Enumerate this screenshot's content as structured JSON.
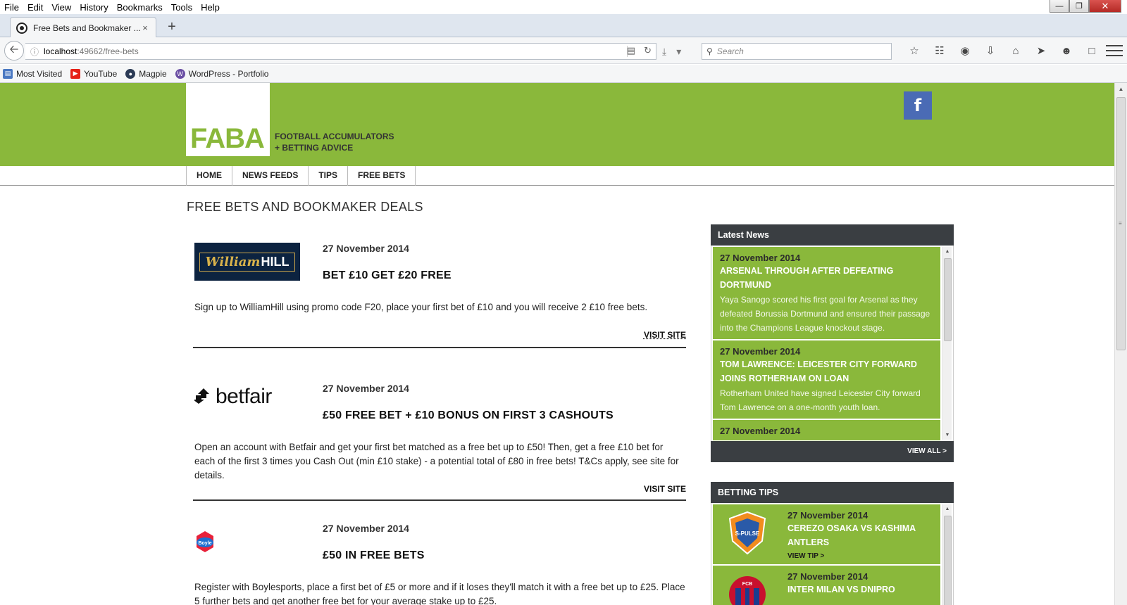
{
  "browser": {
    "menu": [
      "File",
      "Edit",
      "View",
      "History",
      "Bookmarks",
      "Tools",
      "Help"
    ],
    "tab_title": "Free Bets and Bookmaker ...",
    "tab_close": "×",
    "new_tab": "+",
    "url_host": "localhost",
    "url_path": ":49662/free-bets",
    "search_placeholder": "Search",
    "bookmarks": [
      {
        "label": "Most Visited",
        "icon": "most-visited-icon",
        "color": "#4a78c2"
      },
      {
        "label": "YouTube",
        "icon": "youtube-icon",
        "color": "#e62117"
      },
      {
        "label": "Magpie",
        "icon": "magpie-icon",
        "color": "#2b3a55"
      },
      {
        "label": "WordPress - Portfolio",
        "icon": "wordpress-icon",
        "color": "#6a4ea3"
      }
    ]
  },
  "site": {
    "logo": "FABA",
    "tagline_line1": "FOOTBALL ACCUMULATORS",
    "tagline_line2": "+ BETTING ADVICE",
    "facebook": "f",
    "nav": [
      "HOME",
      "NEWS FEEDS",
      "TIPS",
      "FREE BETS"
    ],
    "page_title": "FREE BETS AND BOOKMAKER DEALS"
  },
  "deals": [
    {
      "brand": "William HILL",
      "brand_part1": "William",
      "brand_part2": "HILL",
      "date": "27 November 2014",
      "headline": "BET £10 GET £20 FREE",
      "description": "Sign up to WilliamHill using promo code F20, place your first bet of £10 and you will receive 2 £10 free bets.",
      "visit": "VISIT SITE"
    },
    {
      "brand": "betfair",
      "date": "27 November 2014",
      "headline": "£50 FREE BET + £10 BONUS ON FIRST 3 CASHOUTS",
      "description": "Open an account with Betfair and get your first bet matched as a free bet up to £50! Then, get a free £10 bet for each of the first 3 times you Cash Out (min £10 stake) - a potential total of £80 in free bets! T&Cs apply, see site for details.",
      "visit": "VISIT SITE"
    },
    {
      "brand": "Boyle",
      "date": "27 November 2014",
      "headline": "£50 IN FREE BETS",
      "description": "Register with Boylesports, place a first bet of £5 or more and if it loses they'll match it with a free bet up to £25. Place 5 further bets and get another free bet for your average stake up to £25."
    }
  ],
  "latest_news": {
    "heading": "Latest News",
    "items": [
      {
        "date": "27 November 2014",
        "title": "ARSENAL THROUGH AFTER DEFEATING DORTMUND",
        "text": "Yaya Sanogo scored his first goal for Arsenal as they defeated Borussia Dortmund and ensured their passage into the Champions League knockout stage."
      },
      {
        "date": "27 November 2014",
        "title": "TOM LAWRENCE: LEICESTER CITY FORWARD JOINS ROTHERHAM ON LOAN",
        "text": "Rotherham United have signed Leicester City forward Tom Lawrence on a one-month youth loan."
      },
      {
        "date": "27 November 2014",
        "title": "",
        "text": ""
      }
    ],
    "view_all": "VIEW ALL >"
  },
  "betting_tips": {
    "heading": "BETTING TIPS",
    "items": [
      {
        "date": "27 November 2014",
        "title": "CEREZO OSAKA VS KASHIMA ANTLERS",
        "link": "VIEW TIP >",
        "badge": "S-PULSE"
      },
      {
        "date": "27 November 2014",
        "title": "INTER MILAN VS DNIPRO",
        "link": "VIEW TIP >",
        "badge": "FCB"
      }
    ]
  },
  "colors": {
    "brand_green": "#8ab83b",
    "dark_panel": "#3a3e42",
    "facebook_blue": "#4a6bb5",
    "william_hill_navy": "#0c2340"
  }
}
